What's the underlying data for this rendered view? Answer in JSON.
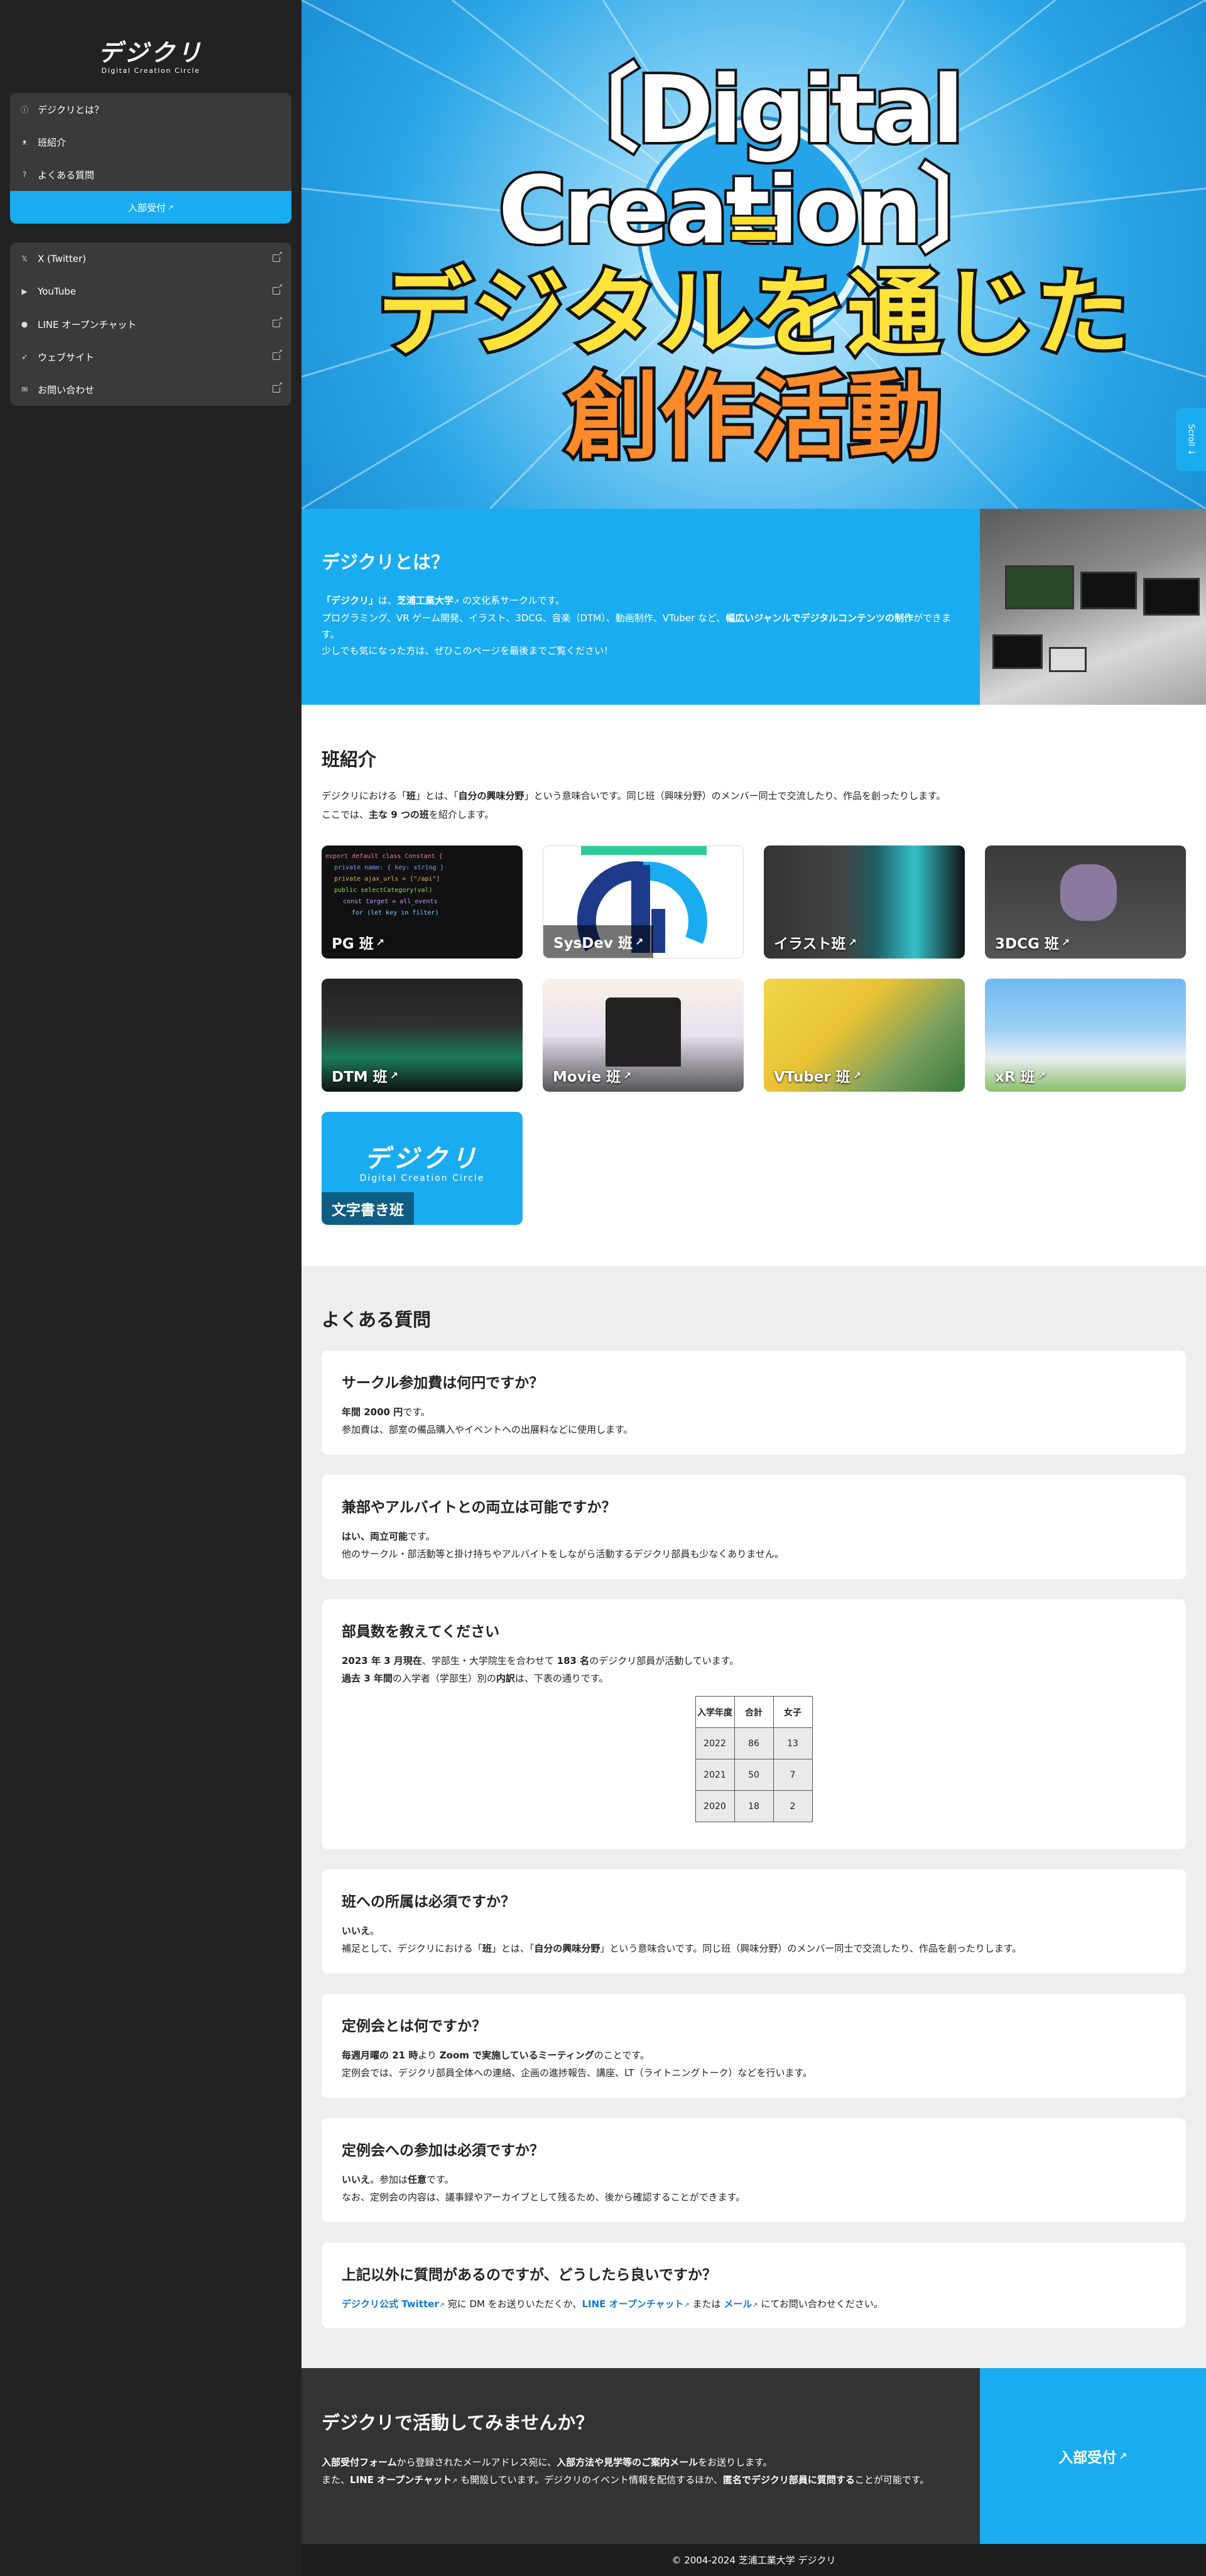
{
  "sidebar": {
    "logo_main": "デジクリ",
    "logo_sub": "Digital Creation Circle",
    "nav": [
      {
        "label": "デジクリとは？",
        "icon": "info-icon"
      },
      {
        "label": "班紹介",
        "icon": "people-icon"
      },
      {
        "label": "よくある質問",
        "icon": "question-icon"
      }
    ],
    "join_label": "入部受付",
    "links": [
      {
        "label": "X (Twitter)",
        "icon": "x-icon"
      },
      {
        "label": "YouTube",
        "icon": "youtube-icon"
      },
      {
        "label": "LINE オープンチャット",
        "icon": "line-icon"
      },
      {
        "label": "ウェブサイト",
        "icon": "rocket-icon"
      },
      {
        "label": "お問い合わせ",
        "icon": "mail-icon"
      }
    ]
  },
  "hero": {
    "line1": "〔Digital Creation〕",
    "equals": "=",
    "line2": "デジタルを通じた",
    "line3": "創作活動",
    "scroll_label": "Scroll ↓"
  },
  "about": {
    "title": "デジクリとは？",
    "p1_a": "「デジクリ」",
    "p1_b": "は、",
    "p1_c": "芝浦工業大学",
    "p1_d": " の文化系サークルです。",
    "p2_a": "プログラミング、VR ゲーム開発、イラスト、3DCG、音楽（DTM）、動画制作、VTuber など、",
    "p2_b": "幅広いジャンルでデジタルコンテンツの制作",
    "p2_c": "ができます。",
    "p3": "少しでも気になった方は、ぜひこのページを最後までご覧ください！"
  },
  "clubs": {
    "title": "班紹介",
    "desc1_a": "デジクリにおける「",
    "desc1_b": "班",
    "desc1_c": "」とは、「",
    "desc1_d": "自分の興味分野",
    "desc1_e": "」という意味合いです。同じ班（興味分野）のメンバー同士で交流したり、作品を創ったりします。",
    "desc2_a": "ここでは、",
    "desc2_b": "主な 9 つの班",
    "desc2_c": "を紹介します。",
    "items": [
      {
        "label": "PG 班"
      },
      {
        "label": "SysDev 班"
      },
      {
        "label": "イラスト班"
      },
      {
        "label": "3DCG 班"
      },
      {
        "label": "DTM 班"
      },
      {
        "label": "Movie 班"
      },
      {
        "label": "VTuber 班"
      },
      {
        "label": "xR 班"
      },
      {
        "label": "文字書き班"
      }
    ]
  },
  "faq": {
    "title": "よくある質問",
    "q1": {
      "q": "サークル参加費は何円ですか？",
      "a1": "年間 2000 円",
      "a1b": "です。",
      "a2": "参加費は、部室の備品購入やイベントへの出展料などに使用します。"
    },
    "q2": {
      "q": "兼部やアルバイトとの両立は可能ですか？",
      "a1": "はい、両立可能",
      "a1b": "です。",
      "a2": "他のサークル・部活動等と掛け持ちやアルバイトをしながら活動するデジクリ部員も少なくありません。"
    },
    "q3": {
      "q": "部員数を教えてください",
      "a1": "2023 年 3 月現在",
      "a1b": "、学部生・大学院生を合わせて ",
      "a1c": "183 名",
      "a1d": "のデジクリ部員が活動しています。",
      "a2": "過去 3 年間",
      "a2b": "の入学者（学部生）別の",
      "a2c": "内訳",
      "a2d": "は、下表の通りです。",
      "table": {
        "headers": [
          "入学年度",
          "合計",
          "女子"
        ],
        "rows": [
          [
            "2022",
            "86",
            "13"
          ],
          [
            "2021",
            "50",
            "7"
          ],
          [
            "2020",
            "18",
            "2"
          ]
        ]
      }
    },
    "q4": {
      "q": "班への所属は必須ですか？",
      "a1": "いいえ",
      "a1b": "。",
      "a2": "補足として、デジクリにおける「",
      "a2b": "班",
      "a2c": "」とは、「",
      "a2d": "自分の興味分野",
      "a2e": "」という意味合いです。同じ班（興味分野）のメンバー同士で交流したり、作品を創ったりします。"
    },
    "q5": {
      "q": "定例会とは何ですか？",
      "a1": "毎週月曜の 21 時",
      "a1b": "より ",
      "a1c": "Zoom で実施しているミーティング",
      "a1d": "のことです。",
      "a2": "定例会では、デジクリ部員全体への連絡、企画の進捗報告、講座、LT（ライトニングトーク）などを行います。"
    },
    "q6": {
      "q": "定例会への参加は必須ですか？",
      "a1": "いいえ",
      "a1b": "。参加は",
      "a1c": "任意",
      "a1d": "です。",
      "a2": "なお、定例会の内容は、議事録やアーカイブとして残るため、後から確認することができます。"
    },
    "q7": {
      "q": "上記以外に質問があるのですが、どうしたら良いですか？",
      "l1": "デジクリ公式 Twitter",
      "t1": " 宛に DM をお送りいただくか、",
      "l2": "LINE オープンチャット",
      "t2": " または ",
      "l3": "メール",
      "t3": " にてお問い合わせください。"
    }
  },
  "join": {
    "title": "デジクリで活動してみませんか？",
    "p1_a": "入部受付フォーム",
    "p1_b": "から登録されたメールアドレス宛に、",
    "p1_c": "入部方法や見学等のご案内メール",
    "p1_d": "をお送りします。",
    "p2_a": "また、",
    "p2_b": "LINE オープンチャット",
    "p2_c": " も開設しています。デジクリのイベント情報を配信するほか、",
    "p2_d": "匿名でデジクリ部員に質問する",
    "p2_e": "ことが可能です。",
    "button": "入部受付"
  },
  "footer": "© 2004-2024 芝浦工業大学 デジクリ",
  "colors": {
    "accent": "#1aacf0",
    "sidebar": "#222222",
    "link": "#1279d6"
  }
}
